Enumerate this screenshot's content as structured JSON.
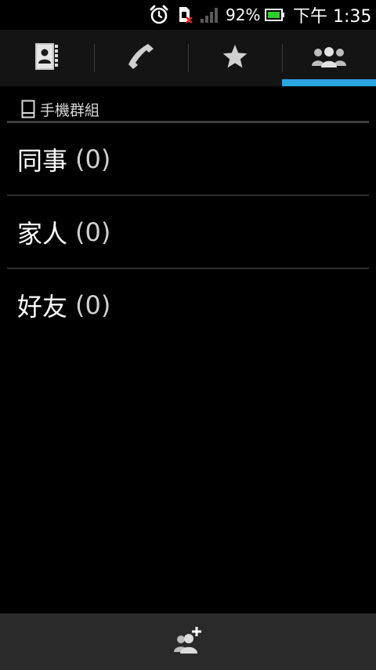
{
  "status_bar": {
    "battery_percent": "92%",
    "time": "下午 1:35",
    "icons": [
      "alarm-icon",
      "sim-missing-icon",
      "signal-icon",
      "battery-icon"
    ],
    "battery_color": "#2ad12a"
  },
  "tabs": [
    {
      "icon": "contacts-book-icon",
      "selected": false
    },
    {
      "icon": "phone-icon",
      "selected": false
    },
    {
      "icon": "star-icon",
      "selected": false
    },
    {
      "icon": "groups-icon",
      "selected": true
    }
  ],
  "accent_color": "#2aa6e0",
  "section": {
    "title": "手機群組",
    "icon": "phone-device-icon"
  },
  "groups": [
    {
      "name": "同事",
      "count": "(0)"
    },
    {
      "name": "家人",
      "count": "(0)"
    },
    {
      "name": "好友",
      "count": "(0)"
    }
  ],
  "bottom_bar": {
    "icon": "add-group-icon"
  }
}
